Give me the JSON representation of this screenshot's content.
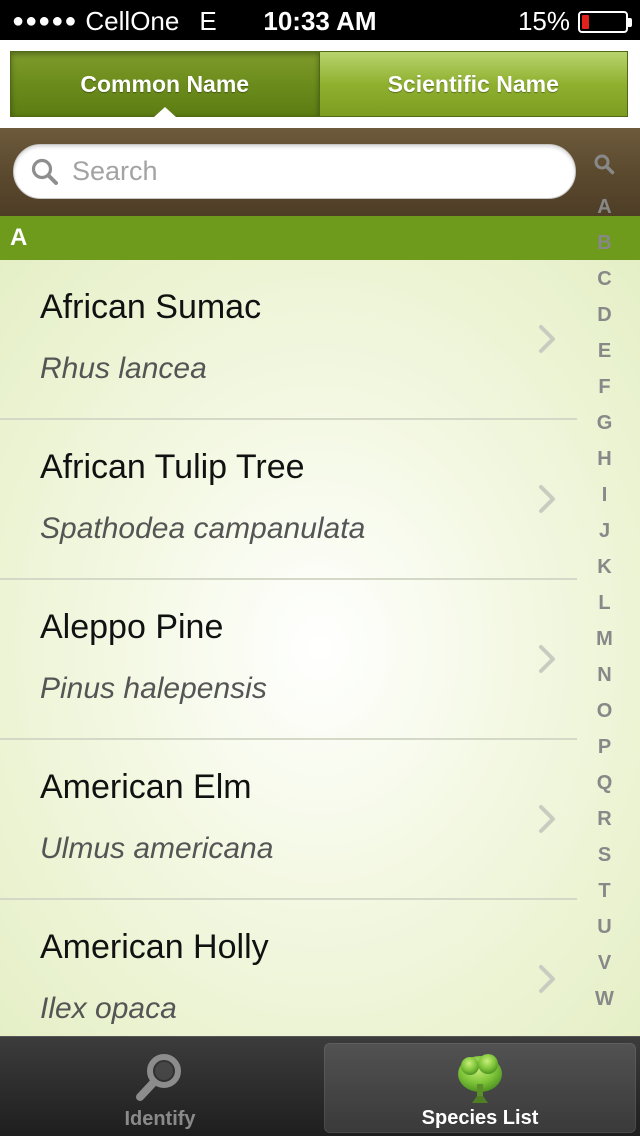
{
  "status": {
    "signal_dots": "●●●●●",
    "carrier": "CellOne",
    "network": "E",
    "time": "10:33 AM",
    "battery": "15%",
    "battery_level": 0.15,
    "battery_color": "#e0211c"
  },
  "segment": {
    "tabs": [
      {
        "label": "Common Name",
        "selected": true
      },
      {
        "label": "Scientific Name",
        "selected": false
      }
    ]
  },
  "search": {
    "placeholder": "Search"
  },
  "section": {
    "title": "A"
  },
  "list": {
    "items": [
      {
        "name": "African Sumac",
        "scientific": "Rhus lancea"
      },
      {
        "name": "African Tulip Tree",
        "scientific": "Spathodea campanulata"
      },
      {
        "name": "Aleppo Pine",
        "scientific": "Pinus halepensis"
      },
      {
        "name": "American Elm",
        "scientific": "Ulmus americana"
      },
      {
        "name": "American Holly",
        "scientific": "Ilex opaca"
      }
    ]
  },
  "index": {
    "icon": "search-icon",
    "letters": [
      "A",
      "B",
      "C",
      "D",
      "E",
      "F",
      "G",
      "H",
      "I",
      "J",
      "K",
      "L",
      "M",
      "N",
      "O",
      "P",
      "Q",
      "R",
      "S",
      "T",
      "U",
      "V",
      "W"
    ]
  },
  "tabbar": {
    "tabs": [
      {
        "label": "Identify",
        "icon": "magnifier-icon",
        "selected": false
      },
      {
        "label": "Species List",
        "icon": "tree-icon",
        "selected": true
      }
    ]
  },
  "colors": {
    "accent_green": "#6e9b1b",
    "search_bar_brown": "#5c4a2f"
  }
}
